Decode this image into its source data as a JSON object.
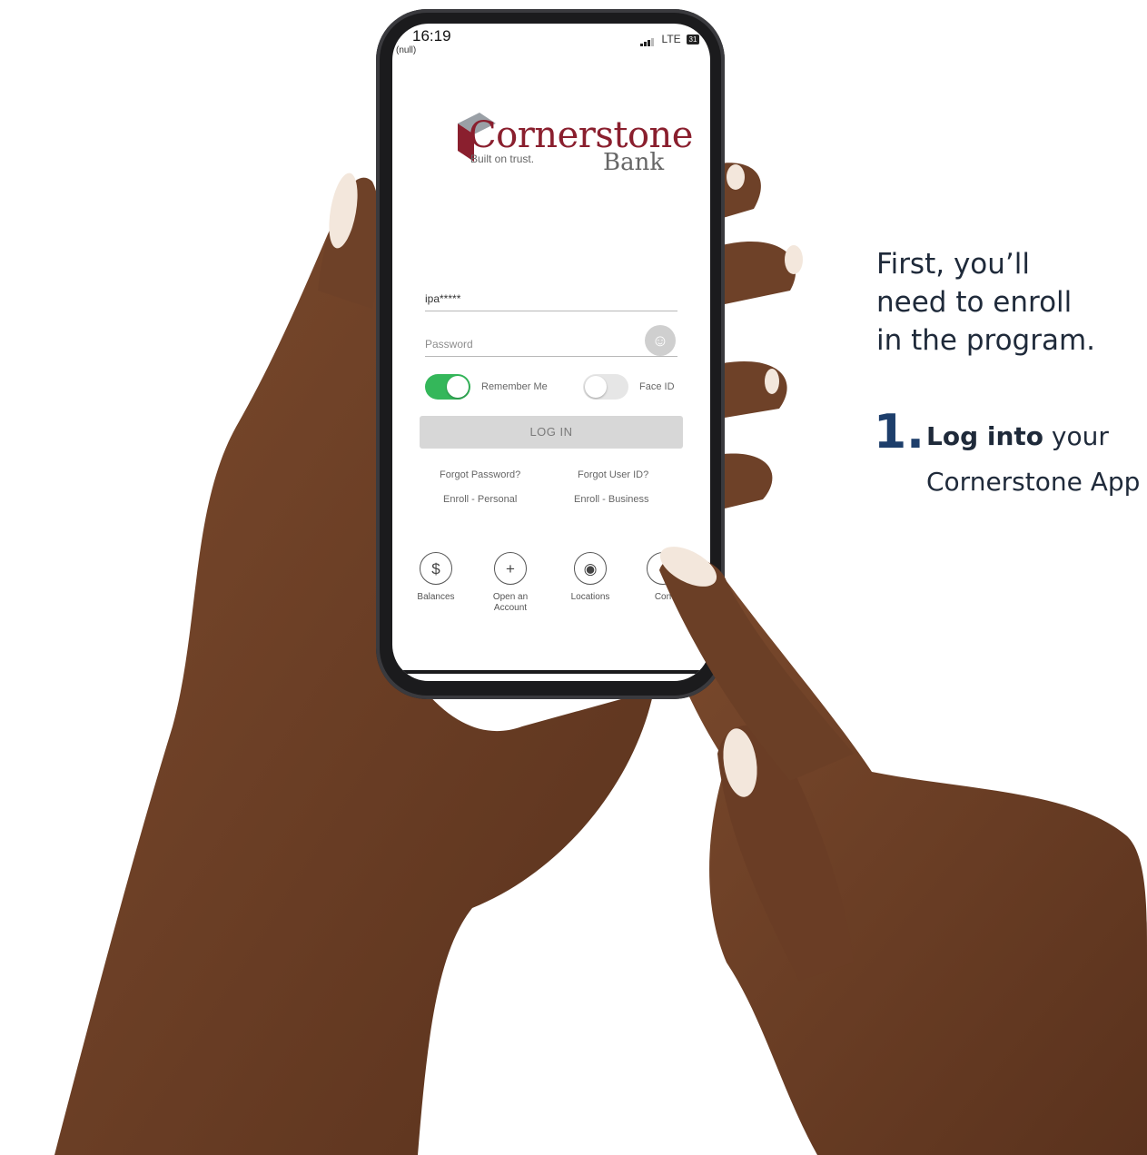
{
  "caption": {
    "line1": "First, you’ll",
    "line2": "need to enroll",
    "line3": "in the program."
  },
  "step": {
    "number": "1.",
    "bold": "Log into",
    "rest": " your",
    "line2": "Cornerstone App"
  },
  "status_bar": {
    "time": "16:19",
    "carrier_note": "(null)",
    "network": "LTE",
    "battery": "31"
  },
  "logo": {
    "brand": "Cornerstone",
    "tagline": "Built on trust.",
    "sub": "Bank"
  },
  "login_form": {
    "username_value": "ipa*****",
    "password_placeholder": "Password",
    "remember_me_label": "Remember Me",
    "remember_me_on": true,
    "face_id_label": "Face ID",
    "face_id_on": false,
    "login_button": "LOG IN"
  },
  "links": {
    "forgot_password": "Forgot Password?",
    "forgot_user_id": "Forgot User ID?",
    "enroll_personal": "Enroll - Personal",
    "enroll_business": "Enroll - Business"
  },
  "quick_nav": [
    {
      "label": "Balances",
      "icon": "dollar-icon",
      "glyph": "$"
    },
    {
      "label": "Open an Account",
      "icon": "add-user-icon",
      "glyph": "+"
    },
    {
      "label": "Locations",
      "icon": "location-pin-icon",
      "glyph": "◉"
    },
    {
      "label": "Con",
      "icon": "contact-icon",
      "glyph": ""
    }
  ],
  "colors": {
    "brand_red": "#8a1f2e",
    "toggle_green": "#34b75a",
    "caption_text": "#1f2a3a",
    "step_number": "#1d3e6b",
    "skin": "#6b3f26"
  }
}
